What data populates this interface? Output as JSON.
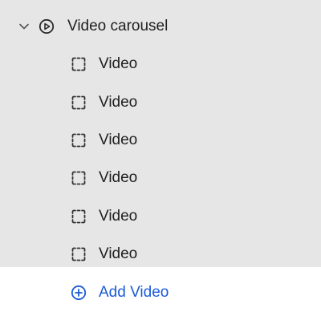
{
  "tree": {
    "parent": {
      "label": "Video carousel",
      "icon": "play-circle-icon",
      "expand_icon": "chevron-down-icon"
    },
    "children": [
      {
        "label": "Video",
        "icon": "dashed-square-icon"
      },
      {
        "label": "Video",
        "icon": "dashed-square-icon"
      },
      {
        "label": "Video",
        "icon": "dashed-square-icon"
      },
      {
        "label": "Video",
        "icon": "dashed-square-icon"
      },
      {
        "label": "Video",
        "icon": "dashed-square-icon"
      },
      {
        "label": "Video",
        "icon": "dashed-square-icon"
      }
    ],
    "add": {
      "label": "Add Video",
      "icon": "plus-circle-icon"
    }
  },
  "colors": {
    "selected_background": "#e6e6e6",
    "link": "#1a5bd6",
    "text": "#1f1f1f",
    "icon": "#3a3a3a"
  }
}
